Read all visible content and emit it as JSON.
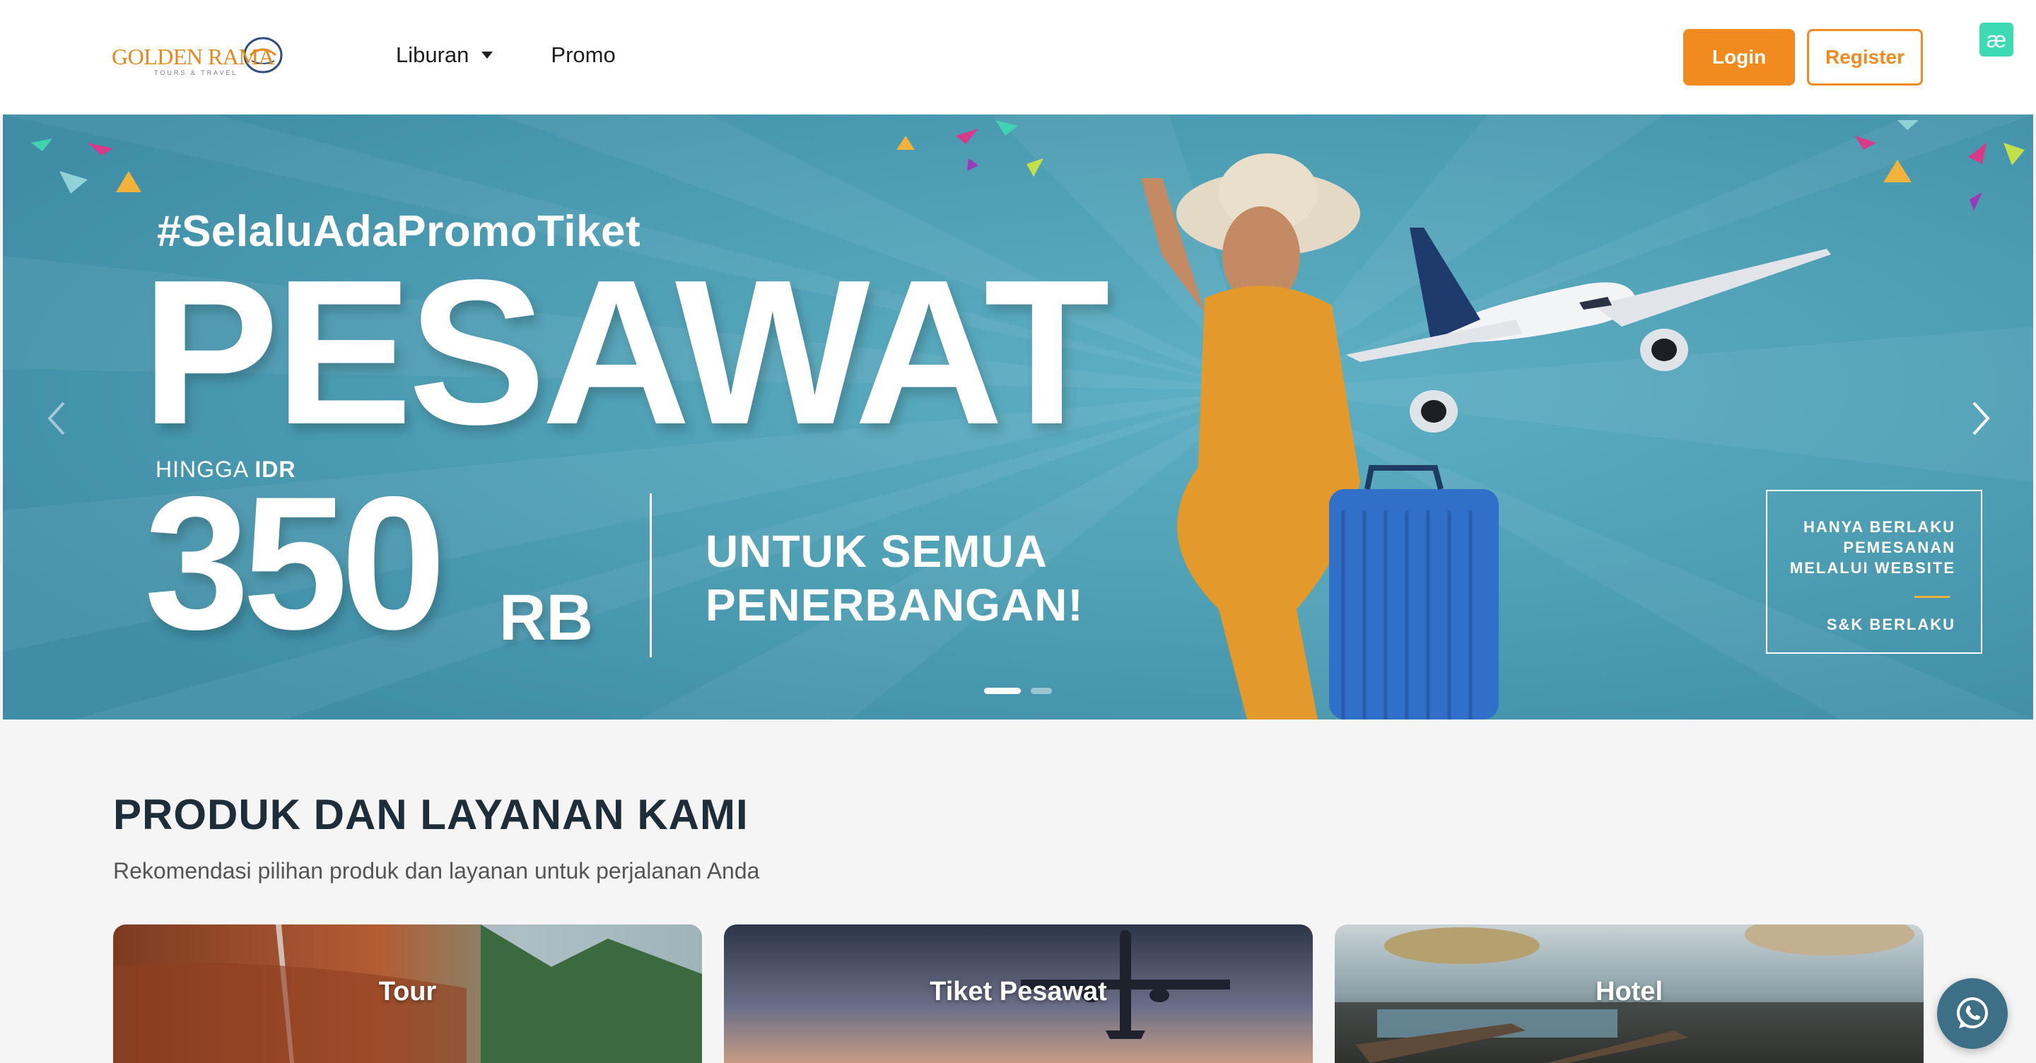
{
  "header": {
    "logo": {
      "name": "GOLDEN RAMA",
      "tagline": "TOURS & TRAVEL"
    },
    "nav": [
      {
        "label": "Liburan",
        "has_dropdown": true
      },
      {
        "label": "Promo",
        "has_dropdown": false
      }
    ],
    "login_label": "Login",
    "register_label": "Register",
    "extension_icon": "æ"
  },
  "hero": {
    "hashtag": "#SelaluAdaPromoTiket",
    "title": "PESAWAT",
    "hingga_prefix": "HINGGA ",
    "hingga_currency": "IDR",
    "amount": "350",
    "amount_unit": "RB",
    "tagline": "UNTUK SEMUA\nPENERBANGAN!",
    "terms_text": "HANYA BERLAKU\nPEMESANAN\nMELALUI WEBSITE",
    "terms_sk": "S&K BERLAKU",
    "slide_count": 2,
    "active_slide": 1,
    "colors": {
      "background": "#4b9cb3",
      "accent": "#f3b23a"
    }
  },
  "products": {
    "title": "PRODUK DAN LAYANAN KAMI",
    "subtitle": "Rekomendasi pilihan produk dan layanan untuk perjalanan Anda",
    "cards": [
      {
        "label": "Tour",
        "icon": "landscape-image"
      },
      {
        "label": "Tiket Pesawat",
        "icon": "airplane-image"
      },
      {
        "label": "Hotel",
        "icon": "resort-pool-image"
      }
    ]
  },
  "floating": {
    "whatsapp_icon": "whatsapp-icon"
  },
  "colors": {
    "brand_orange": "#f18a1f",
    "heading": "#1d2d3a"
  }
}
